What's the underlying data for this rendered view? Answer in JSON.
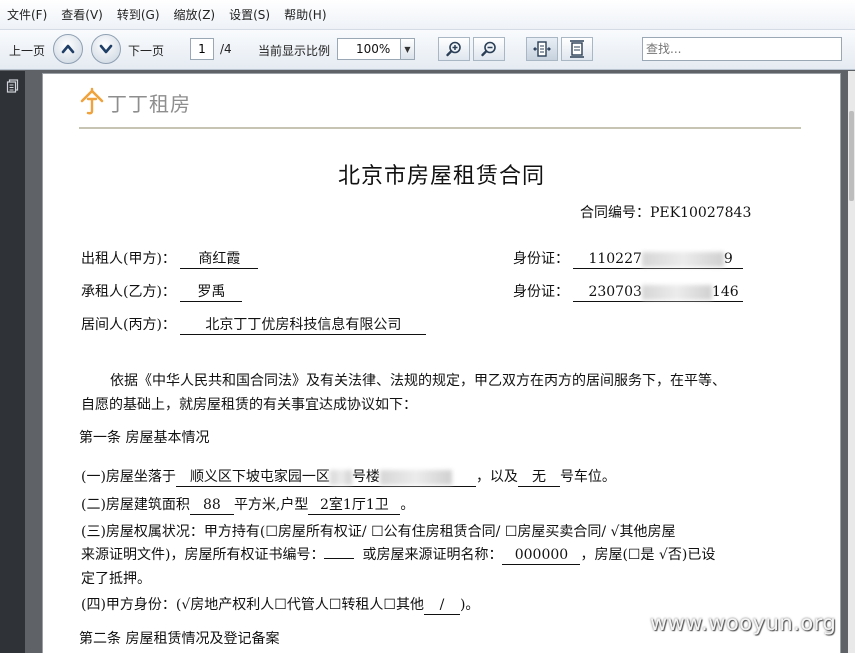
{
  "menu": {
    "items": [
      {
        "label": "文件(F)"
      },
      {
        "label": "查看(V)"
      },
      {
        "label": "转到(G)"
      },
      {
        "label": "缩放(Z)"
      },
      {
        "label": "设置(S)"
      },
      {
        "label": "帮助(H)"
      }
    ]
  },
  "toolbar": {
    "prev_label": "上一页",
    "next_label": "下一页",
    "page_current": "1",
    "page_total": "/4",
    "zoom_label": "当前显示比例",
    "zoom_value": "100%",
    "search_placeholder": "查找..."
  },
  "logo": {
    "text": "丁丁租房"
  },
  "document": {
    "title": "北京市房屋租赁合同",
    "contract_no": "合同编号：PEK10027843",
    "lessor_label": "出租人(甲方)：",
    "lessor_name": "商红霞",
    "lessee_label": "承租人(乙方)：",
    "lessee_name": "罗禹",
    "agent_label": "居间人(丙方)：",
    "agent_name": "北京丁丁优房科技信息有限公司",
    "id_label": "身份证：",
    "lessor_id_start": "110227",
    "lessor_id_end": "9",
    "lessee_id_start": "230703",
    "lessee_id_end": "146",
    "intro_line1": "依据《中华人民共和国合同法》及有关法律、法规的规定，甲乙双方在丙方的居间服务下，在平等、",
    "intro_line2": "自愿的基础上，就房屋租赁的有关事宜达成协议如下：",
    "article1_title": "第一条  房屋基本情况",
    "item1_prefix": "(一)房屋坐落于",
    "item1_location": "顺义区下坡屯家园一区",
    "item1_building": "号楼",
    "item1_mid": "，以及",
    "item1_parking": "无",
    "item1_suffix": "号车位。",
    "item2_prefix": "(二)房屋建筑面积",
    "item2_area": "88",
    "item2_mid": "平方米,户型",
    "item2_layout": "2室1厅1卫",
    "item2_suffix": "。",
    "item3_line1": "(三)房屋权属状况：甲方持有(☐房屋所有权证/   ☐公有住房租赁合同/   ☐房屋买卖合同/   √其他房屋",
    "item3_line2_a": "来源证明文件)，房屋所有权证书编号：",
    "item3_line2_b": "或房屋来源证明名称：",
    "item3_cert_name": "000000",
    "item3_line2_c": "，房屋(☐是   √否)已设",
    "item3_line3": "定了抵押。",
    "item4_prefix": "(四)甲方身份：(√房地产权利人☐代管人☐转租人☐其他",
    "item4_other": "/",
    "item4_suffix": ")。",
    "article2_title": "第二条  房屋租赁情况及登记备案"
  },
  "watermark": {
    "text": "www.wooyun.org"
  }
}
